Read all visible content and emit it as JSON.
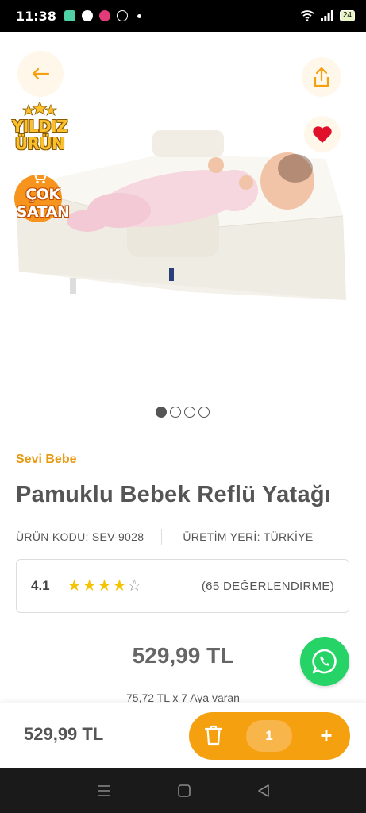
{
  "status_bar": {
    "time": "11:38",
    "battery": "24"
  },
  "product_image": {
    "badge_star": "YILDIZ ÜRÜN",
    "badge_sale": "ÇOK SATAN",
    "slides_total": 4,
    "slide_active": 1
  },
  "product": {
    "brand": "Sevi Bebe",
    "title": "Pamuklu Bebek Reflü Yatağı",
    "code": "ÜRÜN KODU: SEV-9028",
    "origin": "ÜRETİM YERİ: TÜRKİYE",
    "rating": "4.1",
    "rating_stars": 4,
    "rating_max": 5,
    "rating_count": "(65 DEĞERLENDİRME)",
    "price": "529,99 TL",
    "installment": "75,72 TL x 7 Aya varan"
  },
  "cart_bar": {
    "price": "529,99 TL",
    "quantity": "1",
    "plus": "+"
  },
  "colors": {
    "accent": "#f5a00f",
    "brand": "#e79a12",
    "whatsapp": "#25d366",
    "heart": "#e0102a"
  }
}
